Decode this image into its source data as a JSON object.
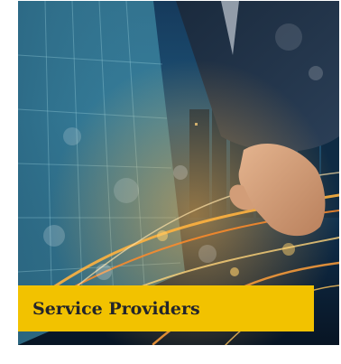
{
  "card": {
    "title": "Service Providers",
    "image_subject": "businessman-hand-city-skyline-light-trails",
    "accent_color": "#f2c200",
    "text_color": "#23252b"
  }
}
